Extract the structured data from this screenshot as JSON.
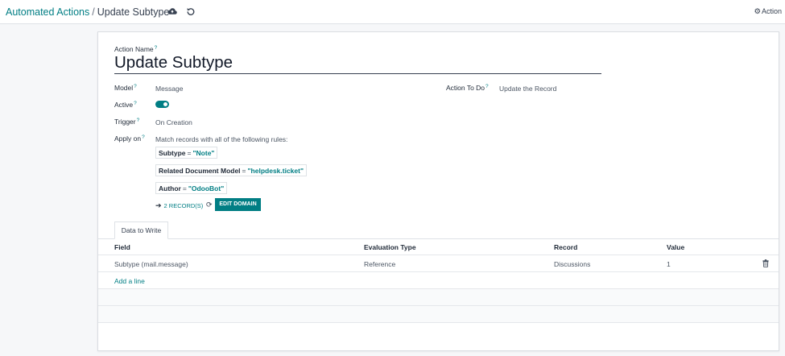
{
  "breadcrumb": {
    "parent": "Automated Actions",
    "separator": "/",
    "current": "Update Subtype"
  },
  "toolbar": {
    "action_label": "Action"
  },
  "form": {
    "action_name_label": "Action Name",
    "action_name_value": "Update Subtype",
    "model_label": "Model",
    "model_value": "Message",
    "active_label": "Active",
    "active_value": true,
    "trigger_label": "Trigger",
    "trigger_value": "On Creation",
    "apply_on_label": "Apply on",
    "apply_on_intro": "Match records with all of the following rules:",
    "action_to_do_label": "Action To Do",
    "action_to_do_value": "Update the Record",
    "tooltip_mark": "?"
  },
  "domain_rules": [
    {
      "field": "Subtype",
      "operator": "=",
      "value": "\"Note\""
    },
    {
      "field": "Related Document Model",
      "operator": "=",
      "value": "\"helpdesk.ticket\""
    },
    {
      "field": "Author",
      "operator": "=",
      "value": "\"OdooBot\""
    }
  ],
  "domain_footer": {
    "records_label": "2 RECORD(S)",
    "edit_domain_label": "EDIT DOMAIN"
  },
  "tabs": [
    {
      "label": "Data to Write",
      "active": true
    }
  ],
  "table": {
    "headers": [
      "Field",
      "Evaluation Type",
      "Record",
      "Value"
    ],
    "rows": [
      [
        "Subtype (mail.message)",
        "Reference",
        "Discussions",
        "1"
      ]
    ],
    "add_line_label": "Add a line"
  },
  "colors": {
    "accent": "#017e84",
    "background": "#f6f7f9",
    "sheet": "#ffffff"
  },
  "icons": [
    "cloud-upload-icon",
    "undo-icon",
    "gear-icon",
    "arrow-right-icon",
    "refresh-icon",
    "trash-icon"
  ]
}
